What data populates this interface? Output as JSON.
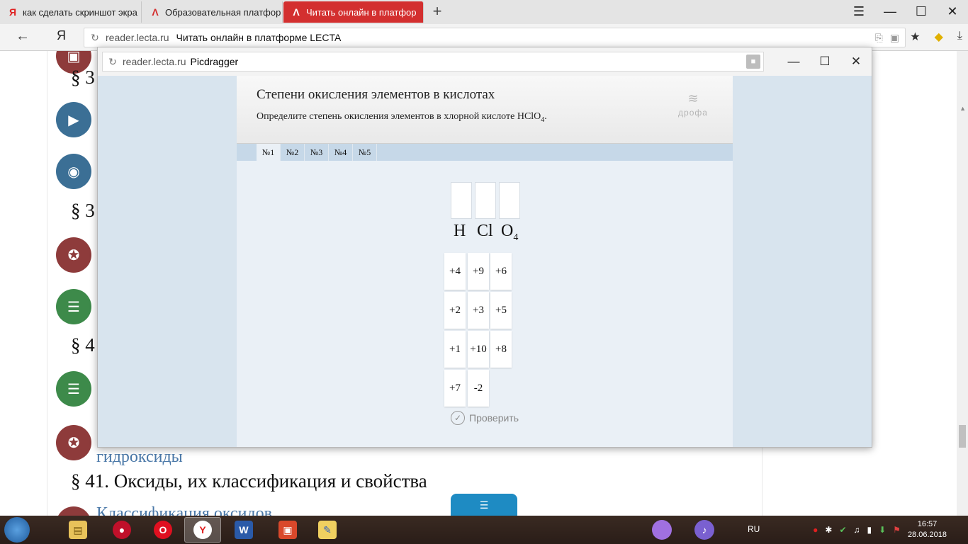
{
  "browser": {
    "tabs": [
      {
        "label": "как сделать скриншот экра",
        "favicon": "Я",
        "favicon_color": "#e02020"
      },
      {
        "label": "Образовательная платфор",
        "favicon": "Λ",
        "favicon_color": "#d32f2f"
      },
      {
        "label": "Читать онлайн в платфор",
        "favicon": "Λ",
        "favicon_color": "#ffffff",
        "active": true
      }
    ],
    "new_tab": "+",
    "address": {
      "domain": "reader.lecta.ru",
      "page_title": "Читать онлайн в платформе LECTA"
    }
  },
  "background_page": {
    "sections": [
      {
        "text": "§ 3"
      },
      {
        "text": "§ 3"
      },
      {
        "text": "§ 4"
      },
      {
        "text": "§ 41. Оксиды, их классификация и свойства"
      }
    ],
    "links": [
      {
        "text": "гидроксиды"
      },
      {
        "text": "Классификация оксидов"
      }
    ]
  },
  "popup": {
    "address": {
      "domain": "reader.lecta.ru",
      "page_title": "Picdragger"
    },
    "exercise": {
      "title": "Степени окисления элементов в кислотах",
      "description": "Определите степень окисления элементов в хлорной кислоте HClO",
      "description_sub": "4",
      "description_end": ".",
      "logo_text": "дрофа",
      "tabs": [
        "№1",
        "№2",
        "№3",
        "№4",
        "№5"
      ],
      "active_tab": 0,
      "formula": [
        {
          "symbol": "H"
        },
        {
          "symbol": "Cl"
        },
        {
          "symbol": "O",
          "sub": "4"
        }
      ],
      "chips": [
        [
          "+4",
          "+9",
          "+6"
        ],
        [
          "+2",
          "+3",
          "+5"
        ],
        [
          "+1",
          "+10",
          "+8"
        ],
        [
          "+7",
          "-2"
        ]
      ],
      "check_label": "Проверить"
    }
  },
  "taskbar": {
    "lang": "RU",
    "time": "16:57",
    "date": "28.06.2018"
  },
  "colors": {
    "accent_red": "#d32f2f",
    "link_blue": "#4a78a8",
    "exercise_bg": "#eaf0f6",
    "pulltab_blue": "#1e8bc3"
  }
}
